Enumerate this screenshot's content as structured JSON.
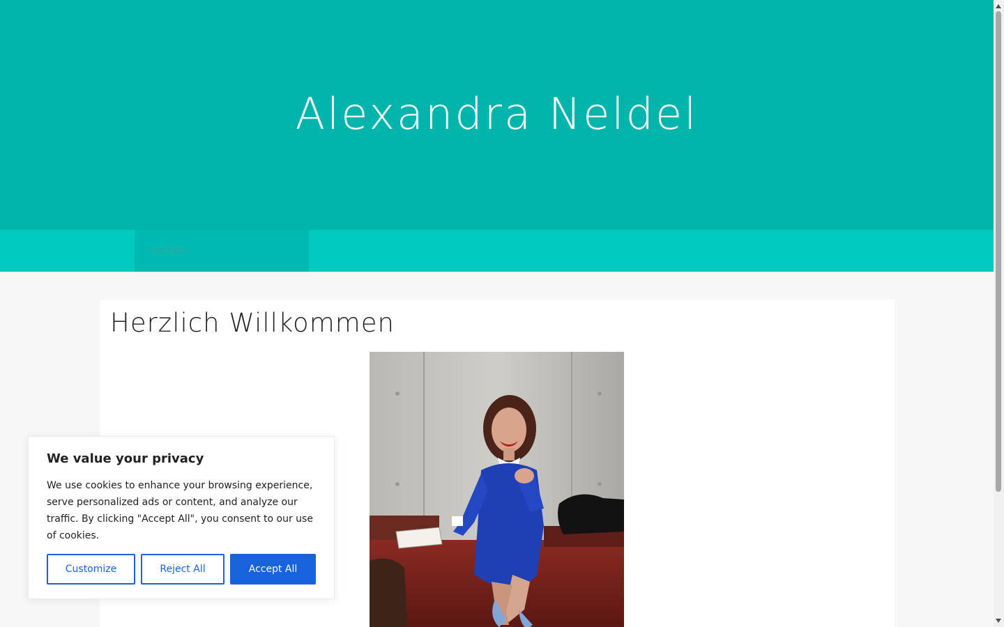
{
  "header": {
    "site_title": "Alexandra Neldel"
  },
  "nav": {
    "search_placeholder": "Suchen"
  },
  "main": {
    "heading": "Herzlich Willkommen",
    "image_alt": "Alexandra Neldel"
  },
  "cookie_banner": {
    "title": "We value your privacy",
    "text": "We use cookies to enhance your browsing experience, serve personalized ads or content, and analyze our traffic. By clicking \"Accept All\", you consent to our use of cookies.",
    "customize_label": "Customize",
    "reject_label": "Reject All",
    "accept_label": "Accept All"
  },
  "colors": {
    "header": "#01b5ad",
    "nav": "#00c9bf",
    "accent": "#1863dc"
  }
}
